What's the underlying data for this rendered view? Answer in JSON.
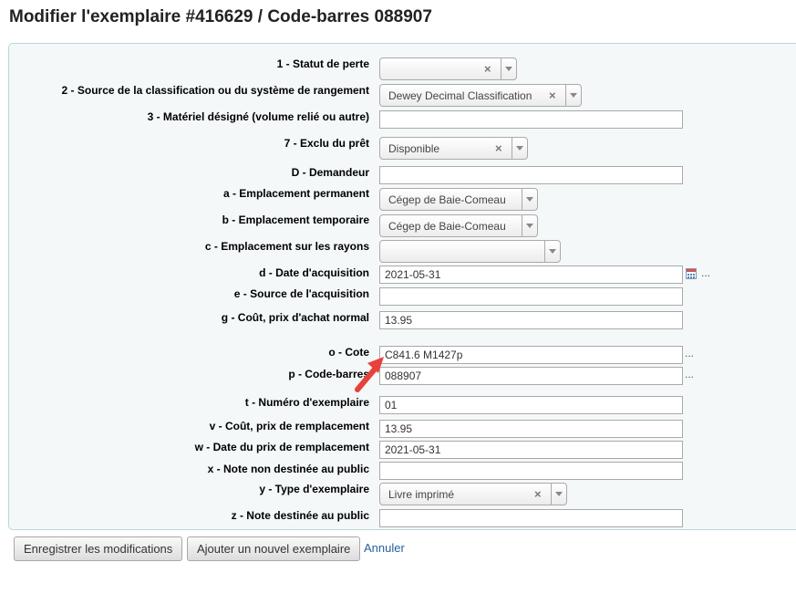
{
  "page": {
    "title": "Modifier l'exemplaire #416629 / Code-barres 088907"
  },
  "fields": {
    "statut_perte": {
      "label": "1 - Statut de perte",
      "value": ""
    },
    "source_classification": {
      "label": "2 - Source de la classification ou du système de rangement",
      "value": "Dewey Decimal Classification"
    },
    "materiel_designe": {
      "label": "3 - Matériel désigné (volume relié ou autre)",
      "value": ""
    },
    "exclu_pret": {
      "label": "7 - Exclu du prêt",
      "value": "Disponible"
    },
    "demandeur": {
      "label": "D - Demandeur",
      "value": ""
    },
    "emplacement_permanent": {
      "label": "a - Emplacement permanent",
      "value": "Cégep de Baie-Comeau"
    },
    "emplacement_temporaire": {
      "label": "b - Emplacement temporaire",
      "value": "Cégep de Baie-Comeau"
    },
    "emplacement_rayons": {
      "label": "c - Emplacement sur les rayons",
      "value": ""
    },
    "date_acquisition": {
      "label": "d - Date d'acquisition",
      "value": "2021-05-31"
    },
    "source_acquisition": {
      "label": "e - Source de l'acquisition",
      "value": ""
    },
    "cout_achat": {
      "label": "g - Coût, prix d'achat normal",
      "value": "13.95"
    },
    "cote": {
      "label": "o - Cote",
      "value": "C841.6 M1427p"
    },
    "code_barres": {
      "label": "p - Code-barres",
      "value": "088907"
    },
    "numero_exemplaire": {
      "label": "t - Numéro d'exemplaire",
      "value": "01"
    },
    "cout_remplacement": {
      "label": "v - Coût, prix de remplacement",
      "value": "13.95"
    },
    "date_prix_remplacement": {
      "label": "w - Date du prix de remplacement",
      "value": "2021-05-31"
    },
    "note_non_publique": {
      "label": "x - Note non destinée au public",
      "value": ""
    },
    "type_exemplaire": {
      "label": "y - Type d'exemplaire",
      "value": "Livre imprimé"
    },
    "note_publique": {
      "label": "z - Note destinée au public",
      "value": ""
    }
  },
  "icons": {
    "clear": "×",
    "ellipsis": "...",
    "clear_icon": "clear-icon",
    "calendar_icon": "calendar-icon",
    "dropdown_icon": "chevron-down-icon",
    "annotation_arrow": "arrow-pointer-icon"
  },
  "colors": {
    "panel_background": "#f4f8f9",
    "panel_border": "#b9d8d9",
    "link": "#1f5f9e",
    "annotation_arrow": "#e8413c"
  },
  "actions": {
    "save_label": "Enregistrer les modifications",
    "add_label": "Ajouter un nouvel exemplaire",
    "cancel_label": "Annuler"
  }
}
